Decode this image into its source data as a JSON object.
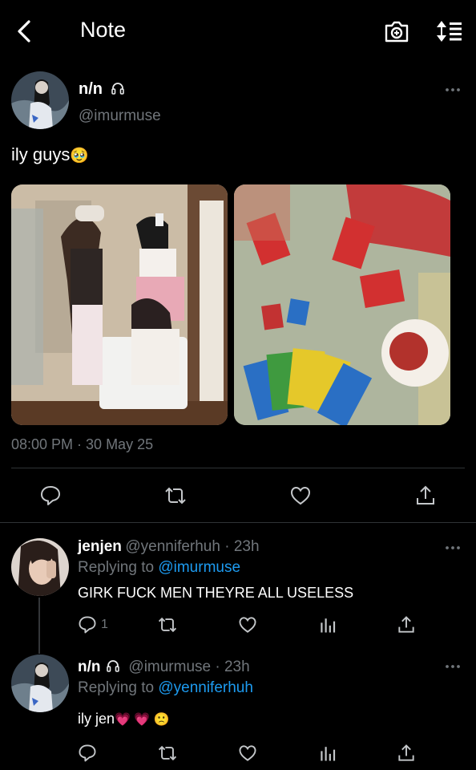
{
  "header": {
    "title": "Note",
    "back_icon": "chevron-left-icon",
    "camera_icon": "camera-icon",
    "sort_icon": "sort-icon"
  },
  "main_tweet": {
    "name": "n/n",
    "name_icon": "headphones-icon",
    "handle": "@imurmuse",
    "text": "ily guys",
    "emoji": "🥹",
    "timestamp": "08:00 PM · 30 May 25"
  },
  "actions": {
    "reply": "reply-icon",
    "retweet": "retweet-icon",
    "like": "like-icon",
    "share": "share-icon"
  },
  "replies": [
    {
      "name": "jenjen",
      "handle_time": "@yenniferhuh · 23h",
      "replying_prefix": "Replying to",
      "replying_to": "@imurmuse",
      "text": "GIRK FUCK MEN THEYRE ALL USELESS",
      "reply_count": "1"
    },
    {
      "name": "n/n",
      "handle_time": "@imurmuse · 23h",
      "replying_prefix": "Replying to",
      "replying_to": "@yenniferhuh",
      "text": "ily jen",
      "emojis": "💗 💗 🙁"
    }
  ],
  "colors": {
    "background": "#000000",
    "muted": "#71767b",
    "accent": "#1d9bf0",
    "divider": "#2f3336"
  }
}
